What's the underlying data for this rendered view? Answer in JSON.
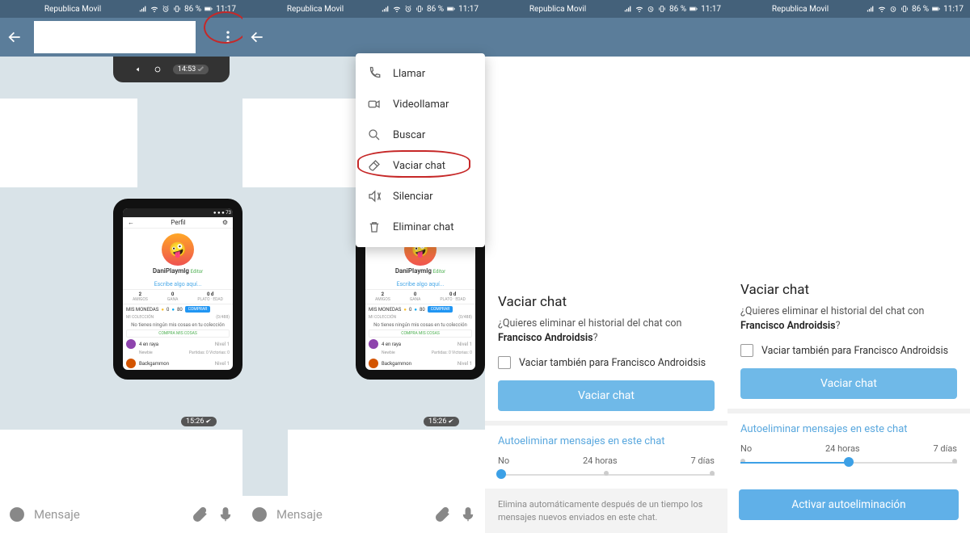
{
  "status": {
    "carrier": "Republica Movil",
    "battery": "86 %",
    "time": "11:17"
  },
  "composer": {
    "placeholder": "Mensaje"
  },
  "embedded": {
    "title": "Perfil",
    "name": "DaniPlaymlg",
    "role": "Editor",
    "write": "Escribe algo aquí...",
    "stats": {
      "amigos_l": "AMIGOS",
      "amigos_v": "2",
      "gana_l": "GANA",
      "gana_v": "0",
      "plato_l": "PLATO · EDAD",
      "plato_v": "0 d"
    },
    "coins_label": "MIS MONEDAS",
    "coins_v": "0",
    "coins_b": "80",
    "buy": "COMPRAR",
    "collect_l": "MI COLECCIÓN",
    "collect_r": "(0/488)",
    "no_collect": "No tienes ningún mis cosas en tu colección",
    "buy2": "COMPRA MIS COSAS",
    "game1": "4 en raya",
    "game1_lvl": "Nivel 1",
    "game1_sub_l": "Newbie",
    "game1_sub_r": "Partidas: 0  Victorias: 0",
    "game2": "Backgammon",
    "game2_lvl": "Nivel 1",
    "time1": "14:53",
    "time2": "15:26"
  },
  "menu": {
    "call": "Llamar",
    "video": "Videollamar",
    "search": "Buscar",
    "clear": "Vaciar chat",
    "mute": "Silenciar",
    "delete": "Eliminar chat"
  },
  "dialog": {
    "title": "Vaciar chat",
    "body_a": "¿Quieres eliminar el historial del chat con ",
    "body_b": "Francisco Androidsis",
    "body_c": "?",
    "checkbox": "Vaciar también para Francisco Androidsis",
    "button": "Vaciar chat",
    "auto_title": "Autoeliminar mensajes en este chat",
    "opt_no": "No",
    "opt_24": "24 horas",
    "opt_7": "7 días",
    "footer": "Elimina automáticamente después de un tiempo los mensajes nuevos enviados en este chat.",
    "activate": "Activar autoeliminación"
  }
}
